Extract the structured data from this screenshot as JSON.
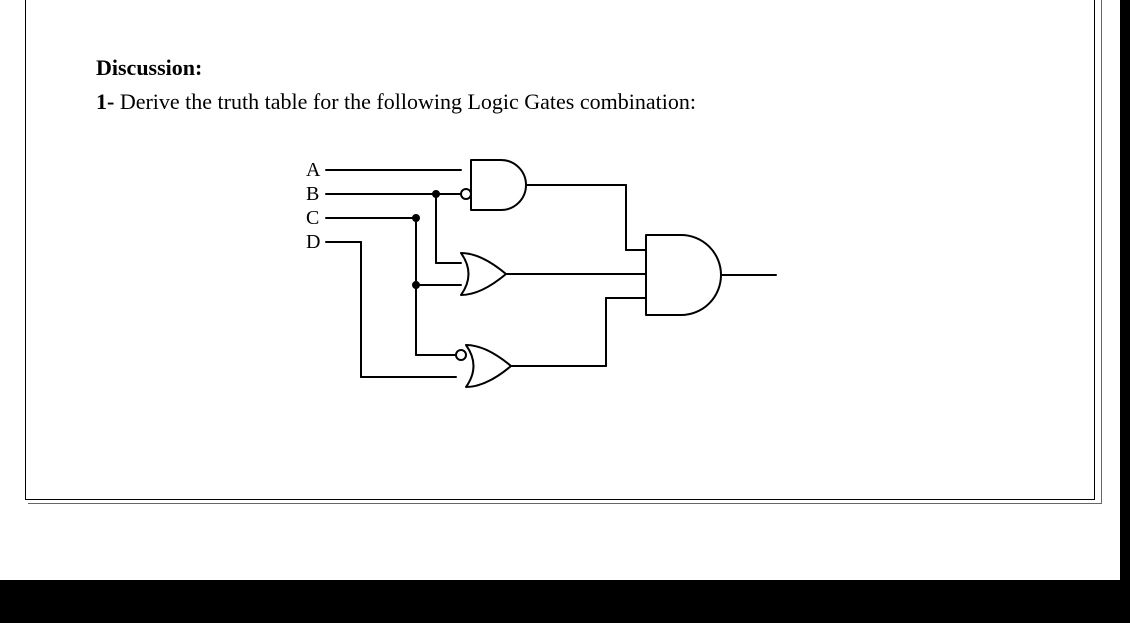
{
  "heading": "Discussion:",
  "question_number": "1-",
  "question_text": " Derive the truth table for the following Logic Gates combination:",
  "inputs": {
    "a": "A",
    "b": "B",
    "c": "C",
    "d": "D"
  }
}
